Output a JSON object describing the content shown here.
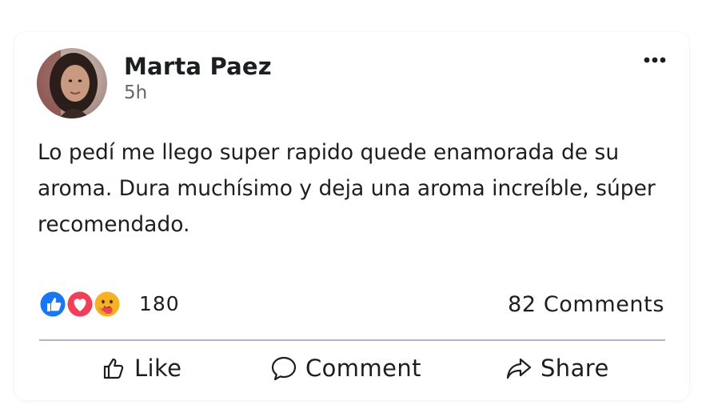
{
  "post": {
    "author": "Marta Paez",
    "time": "5h",
    "text": "Lo pedí me llego super rapido quede enamorada de su aroma. Dura muchísimo y deja una aroma increíble, súper recomendado.",
    "more_icon": "more-horizontal-icon"
  },
  "reactions": {
    "types": [
      "like",
      "love",
      "care"
    ],
    "count": "180"
  },
  "comments": {
    "label": "82 Comments"
  },
  "actions": {
    "like_label": "Like",
    "comment_label": "Comment",
    "share_label": "Share"
  },
  "colors": {
    "like_blue": "#1877f2",
    "love_red": "#f33e58",
    "care_yellow": "#f7b125",
    "divider": "#aab6c8",
    "secondary_text": "#65676b"
  }
}
